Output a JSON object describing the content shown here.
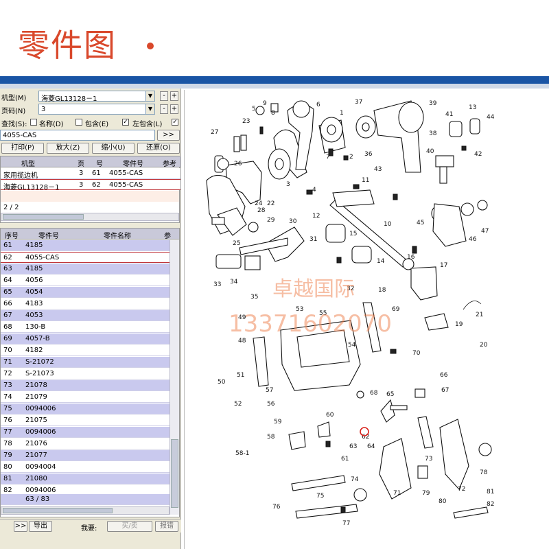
{
  "banner": {
    "title": "零件图"
  },
  "form": {
    "model_label": "机型(M)",
    "model_value": "海菱GL13128－1",
    "page_label": "页码(N)",
    "page_value": "3",
    "search_label": "查找(S):",
    "opt_name": "名称(D)",
    "opt_contains": "包含(E)",
    "opt_left_contains": "左包含(L)",
    "search_value": "4055-CAS",
    "go_button": ">>",
    "minus": "-",
    "plus": "+"
  },
  "toolbar": {
    "print": "打印(P)",
    "zoom_in": "放大(Z)",
    "zoom_out": "缩小(U)",
    "restore": "还原(O)"
  },
  "result_table": {
    "headers": [
      "机型",
      "页",
      "号",
      "零件号",
      "参考"
    ],
    "rows": [
      [
        "家用揽边机",
        "3",
        "61",
        "4055-CAS",
        ""
      ],
      [
        "海菱GL13128－1",
        "3",
        "62",
        "4055-CAS",
        ""
      ]
    ],
    "count": "2 / 2"
  },
  "parts_table": {
    "headers": [
      "序号",
      "零件号",
      "零件名称",
      "参"
    ],
    "rows": [
      [
        "61",
        "4185"
      ],
      [
        "62",
        "4055-CAS"
      ],
      [
        "63",
        "4185"
      ],
      [
        "64",
        "4056"
      ],
      [
        "65",
        "4054"
      ],
      [
        "66",
        "4183"
      ],
      [
        "67",
        "4053"
      ],
      [
        "68",
        "130-B"
      ],
      [
        "69",
        "4057-B"
      ],
      [
        "70",
        "4182"
      ],
      [
        "71",
        "S-21072"
      ],
      [
        "72",
        "S-21073"
      ],
      [
        "73",
        "21078"
      ],
      [
        "74",
        "21079"
      ],
      [
        "75",
        "0094006"
      ],
      [
        "76",
        "21075"
      ],
      [
        "77",
        "0094006"
      ],
      [
        "78",
        "21076"
      ],
      [
        "79",
        "21077"
      ],
      [
        "80",
        "0094004"
      ],
      [
        "81",
        "21080"
      ],
      [
        "82",
        "0094006"
      ]
    ],
    "count": "63 / 83"
  },
  "bottom": {
    "next": ">>",
    "export": "导出",
    "want": "我要:",
    "buy": "买/卖",
    "report": "报错"
  },
  "watermark": {
    "line1": "卓越国际",
    "line2": "13371602070"
  },
  "callouts": [
    "1",
    "2",
    "3",
    "4",
    "5",
    "6",
    "7",
    "8",
    "9",
    "10",
    "11",
    "12",
    "13",
    "14",
    "15",
    "16",
    "17",
    "18",
    "19",
    "20",
    "21",
    "22",
    "23",
    "24",
    "25",
    "26",
    "27",
    "28",
    "29",
    "30",
    "31",
    "32",
    "33",
    "34",
    "35",
    "36",
    "37",
    "38",
    "39",
    "40",
    "41",
    "42",
    "43",
    "44",
    "45",
    "46",
    "47",
    "48",
    "49",
    "50",
    "51",
    "52",
    "53",
    "54",
    "55",
    "56",
    "57",
    "58",
    "58-1",
    "59",
    "60",
    "61",
    "62",
    "63",
    "64",
    "65",
    "66",
    "67",
    "68",
    "69",
    "70",
    "71",
    "72",
    "73",
    "74",
    "75",
    "76",
    "77",
    "78",
    "79",
    "80",
    "81",
    "82"
  ],
  "colors": {
    "accent": "#d9482b",
    "band": "#1a55a5",
    "selected_row": "#c0353a"
  }
}
